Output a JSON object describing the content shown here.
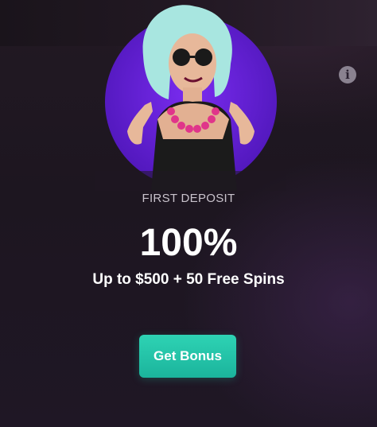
{
  "offer": {
    "subtitle": "FIRST DEPOSIT",
    "percent": "100%",
    "description": "Up to $500 + 50 Free Spins",
    "cta_label": "Get Bonus",
    "info_icon_glyph": "i"
  },
  "colors": {
    "accent_button": "#1fbfa4",
    "hero_circle": "#6a1fe0",
    "background": "#1e1722"
  },
  "icons": {
    "info": "info-icon"
  }
}
